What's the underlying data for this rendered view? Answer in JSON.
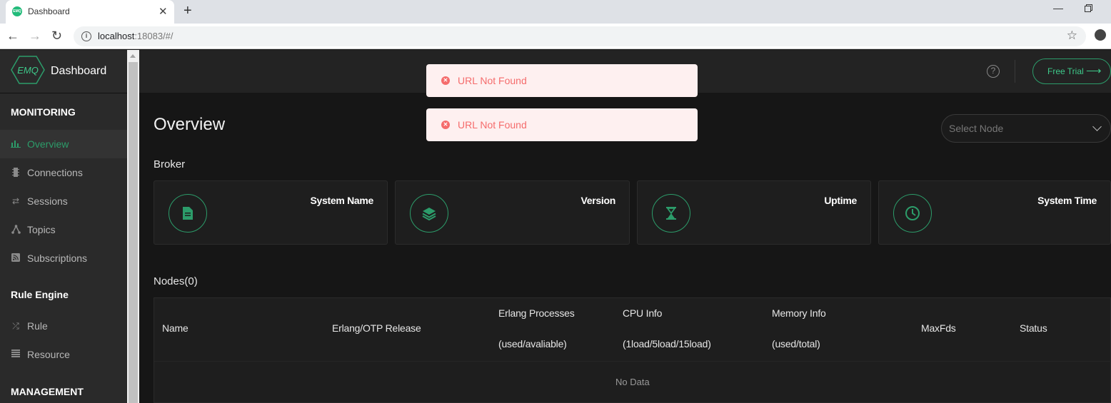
{
  "browser": {
    "tab_title": "Dashboard",
    "favicon_text": "EMQ",
    "url_host": "localhost",
    "url_path": ":18083/#/"
  },
  "app": {
    "logo_text": "EMQ",
    "brand_title": "Dashboard",
    "accent_color": "#2c9c6a"
  },
  "sidebar": {
    "sections": [
      {
        "title": "MONITORING"
      },
      {
        "title": "Rule Engine"
      },
      {
        "title": "MANAGEMENT"
      }
    ],
    "items": [
      {
        "label": "Overview",
        "icon": "bar-chart-icon",
        "active": true
      },
      {
        "label": "Connections",
        "icon": "chip-icon"
      },
      {
        "label": "Sessions",
        "icon": "swap-arrows-icon"
      },
      {
        "label": "Topics",
        "icon": "topic-nodes-icon"
      },
      {
        "label": "Subscriptions",
        "icon": "rss-icon"
      },
      {
        "label": "Rule",
        "icon": "shuffle-icon"
      },
      {
        "label": "Resource",
        "icon": "stack-list-icon"
      }
    ]
  },
  "header": {
    "help_icon": "?",
    "free_trial_label": "Free Trial"
  },
  "main": {
    "page_title": "Overview",
    "select_node_placeholder": "Select Node",
    "broker_label": "Broker",
    "cards": [
      {
        "title": "System Name",
        "icon": "document-icon"
      },
      {
        "title": "Version",
        "icon": "layers-icon"
      },
      {
        "title": "Uptime",
        "icon": "hourglass-icon"
      },
      {
        "title": "System Time",
        "icon": "clock-icon"
      }
    ],
    "nodes_label": "Nodes(0)",
    "table": {
      "columns": [
        {
          "line1": "Name",
          "line2": ""
        },
        {
          "line1": "Erlang/OTP Release",
          "line2": ""
        },
        {
          "line1": "Erlang Processes",
          "line2": "(used/avaliable)"
        },
        {
          "line1": "CPU Info",
          "line2": "(1load/5load/15load)"
        },
        {
          "line1": "Memory Info",
          "line2": "(used/total)"
        },
        {
          "line1": "MaxFds",
          "line2": ""
        },
        {
          "line1": "Status",
          "line2": ""
        }
      ],
      "empty_text": "No Data"
    }
  },
  "toasts": [
    {
      "message": "URL Not Found"
    },
    {
      "message": "URL Not Found"
    }
  ]
}
